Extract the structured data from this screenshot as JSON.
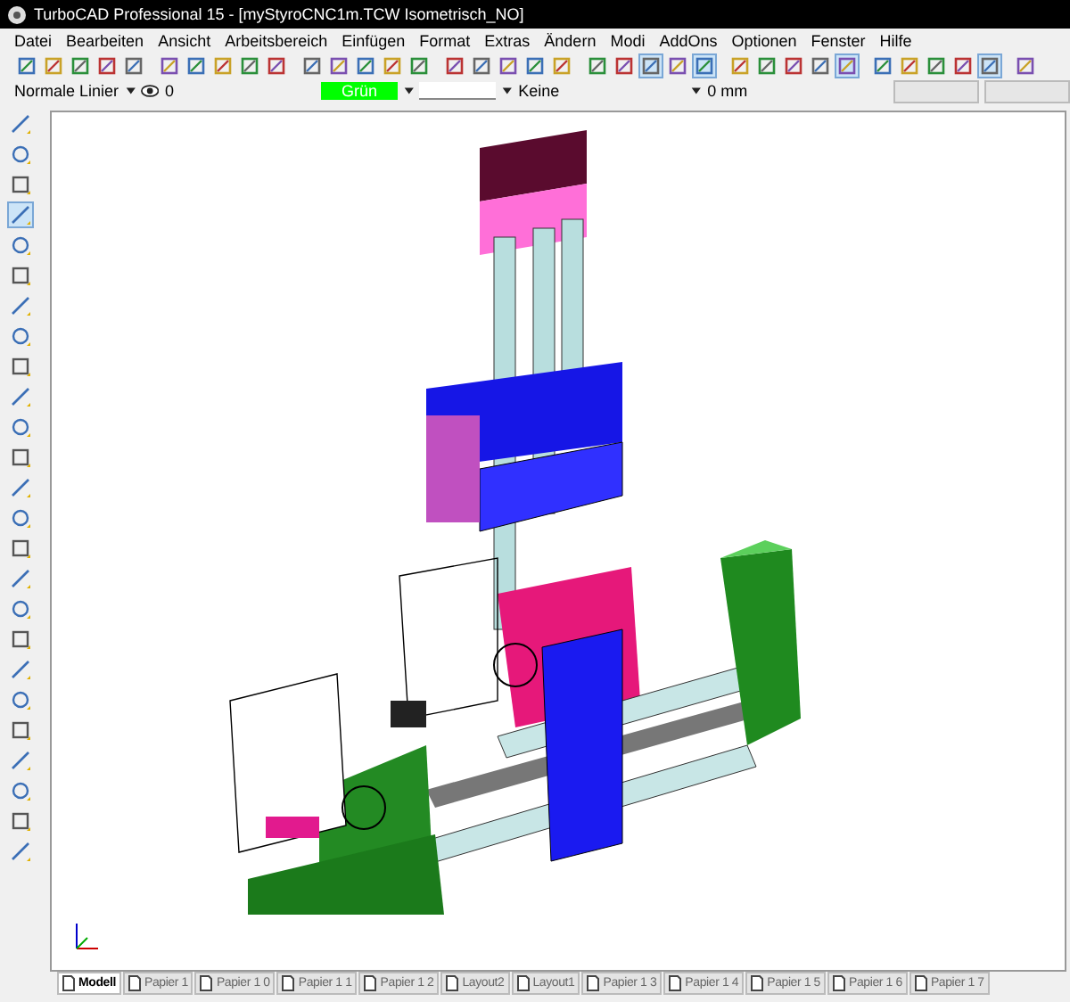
{
  "window": {
    "title": "TurboCAD Professional 15 - [myStyroCNC1m.TCW Isometrisch_NO]"
  },
  "menu": [
    "Datei",
    "Bearbeiten",
    "Ansicht",
    "Arbeitsbereich",
    "Einfügen",
    "Format",
    "Extras",
    "Ändern",
    "Modi",
    "AddOns",
    "Optionen",
    "Fenster",
    "Hilfe"
  ],
  "toolbar": [
    {
      "selected": false
    },
    {
      "selected": false
    },
    {
      "selected": false
    },
    {
      "selected": false
    },
    {
      "selected": false
    },
    {
      "selected": false
    },
    {
      "selected": false
    },
    {
      "selected": false
    },
    {
      "selected": false
    },
    {
      "selected": false
    },
    {
      "selected": false
    },
    {
      "selected": false
    },
    {
      "selected": false
    },
    {
      "selected": false
    },
    {
      "selected": false
    },
    {
      "selected": false
    },
    {
      "selected": false
    },
    {
      "selected": false
    },
    {
      "selected": false
    },
    {
      "selected": false
    },
    {
      "selected": false
    },
    {
      "selected": false
    },
    {
      "selected": true
    },
    {
      "selected": false
    },
    {
      "selected": true
    },
    {
      "selected": false
    },
    {
      "selected": false
    },
    {
      "selected": false
    },
    {
      "selected": false
    },
    {
      "selected": true
    },
    {
      "selected": false
    },
    {
      "selected": false
    },
    {
      "selected": false
    },
    {
      "selected": false
    },
    {
      "selected": true
    },
    {
      "selected": false
    }
  ],
  "properties": {
    "line_style": "Normale Linier",
    "layer": "0",
    "color": {
      "label": "Grün",
      "color": "#00ff00"
    },
    "fill": "Keine",
    "width": "0 mm"
  },
  "tools": [
    {
      "selected": false
    },
    {
      "selected": false
    },
    {
      "selected": false
    },
    {
      "selected": true
    },
    {
      "selected": false
    },
    {
      "selected": false
    },
    {
      "selected": false
    },
    {
      "selected": false
    },
    {
      "selected": false
    },
    {
      "selected": false
    },
    {
      "selected": false
    },
    {
      "selected": false
    },
    {
      "selected": false
    },
    {
      "selected": false
    },
    {
      "selected": false
    },
    {
      "selected": false
    },
    {
      "selected": false
    },
    {
      "selected": false
    },
    {
      "selected": false
    },
    {
      "selected": false
    },
    {
      "selected": false
    },
    {
      "selected": false
    },
    {
      "selected": false
    },
    {
      "selected": false
    },
    {
      "selected": false
    }
  ],
  "tabs": [
    {
      "label": "Modell",
      "selected": true
    },
    {
      "label": "Papier 1",
      "selected": false
    },
    {
      "label": "Papier 1 0",
      "selected": false
    },
    {
      "label": "Papier 1 1",
      "selected": false
    },
    {
      "label": "Papier 1 2",
      "selected": false
    },
    {
      "label": "Layout2",
      "selected": false
    },
    {
      "label": "Layout1",
      "selected": false
    },
    {
      "label": "Papier 1 3",
      "selected": false
    },
    {
      "label": "Papier 1 4",
      "selected": false
    },
    {
      "label": "Papier 1 5",
      "selected": false
    },
    {
      "label": "Papier 1 6",
      "selected": false
    },
    {
      "label": "Papier 1 7",
      "selected": false
    }
  ]
}
